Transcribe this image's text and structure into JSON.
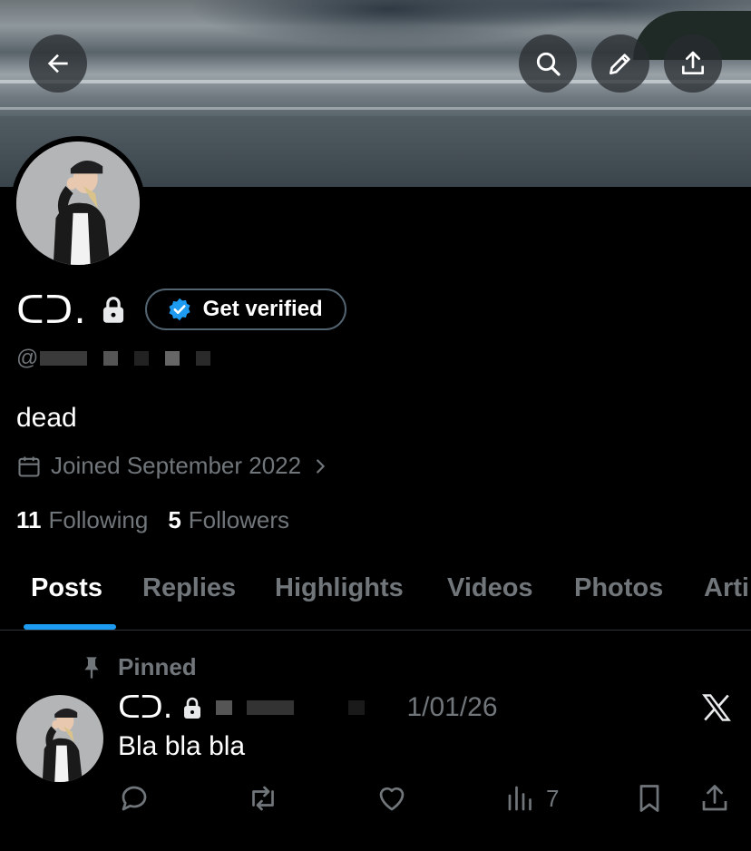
{
  "header": {
    "back_icon": "arrow-left-icon",
    "actions": [
      "search-icon",
      "edit-pencil-icon",
      "share-upload-icon"
    ]
  },
  "profile": {
    "display_name": "ᑕᑐ.",
    "get_verified_label": "Get verified",
    "handle_prefix": "@",
    "bio": "dead",
    "joined_text": "Joined September 2022",
    "following_count": "11",
    "following_label": "Following",
    "followers_count": "5",
    "followers_label": "Followers"
  },
  "tabs": [
    {
      "label": "Posts",
      "active": true
    },
    {
      "label": "Replies",
      "active": false
    },
    {
      "label": "Highlights",
      "active": false
    },
    {
      "label": "Videos",
      "active": false
    },
    {
      "label": "Photos",
      "active": false
    },
    {
      "label": "Arti",
      "active": false
    }
  ],
  "post": {
    "pinned_label": "Pinned",
    "author_name": "ᑕᑐ.",
    "date": "1/01/26",
    "text": "Bla bla bla",
    "views_count": "7"
  },
  "colors": {
    "accent": "#1d9bf0",
    "muted": "#71767b",
    "background": "#000000",
    "text": "#e7e9ea"
  }
}
